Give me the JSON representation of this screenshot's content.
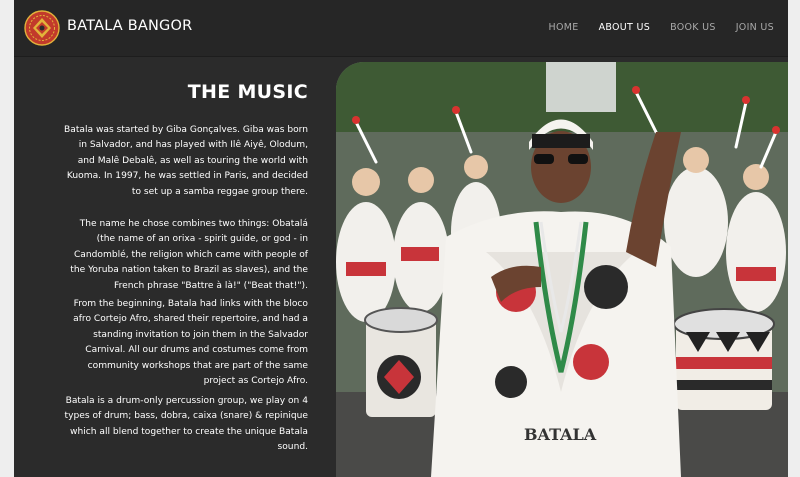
{
  "header": {
    "brand": "BATALA BANGOR",
    "logo_icon": "batala-logo-icon",
    "nav": [
      {
        "label": "HOME",
        "active": false
      },
      {
        "label": "ABOUT US",
        "active": true
      },
      {
        "label": "BOOK US",
        "active": false
      },
      {
        "label": "JOIN US",
        "active": false
      }
    ]
  },
  "main": {
    "title": "THE MUSIC",
    "paragraphs": [
      "Batala was started by Giba Gonçalves. Giba was born in Salvador, and has played with Ilê Aiyê, Olodum, and Malê Debalê, as well as touring the world with Kuoma. In 1997, he was settled in Paris, and decided to set up a samba reggae group there.",
      "The name he chose combines two things: Obatalá (the name of an orixa - spirit guide, or god - in Candomblé, the religion which came with people of the Yoruba nation taken to Brazil as slaves), and the French phrase \"Battre à là!\" (\"Beat that!\").",
      "From the beginning, Batala had links with the bloco afro Cortejo Afro, shared their repertoire, and had a standing invitation to join them in the Salvador Carnival. All our drums and costumes come from community workshops that are part of the same project as Cortejo Afro.",
      "Batala is a drum-only percussion group, we play on 4 types of drum; bass, dobra, caixa (snare) & repinique which all blend together to create the unique Batala sound."
    ],
    "photo_shirt_text": "BATALA"
  },
  "colors": {
    "page_bg": "#2b2b2b",
    "nav_bg": "#262626",
    "logo_red": "#c23a2b",
    "logo_gold": "#e2b23a"
  }
}
